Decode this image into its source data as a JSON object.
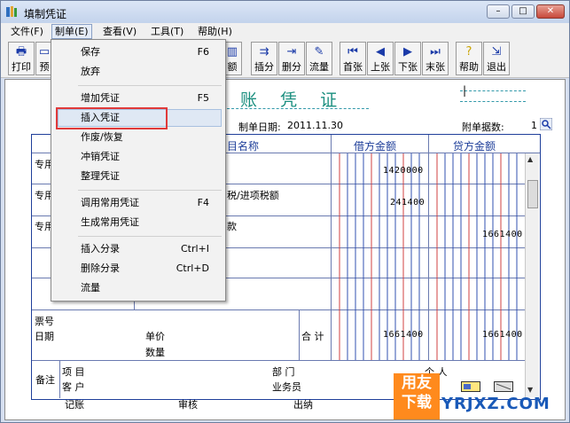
{
  "window": {
    "title": "填制凭证",
    "controls": {
      "minimize": "–",
      "maximize": "□",
      "close": "✕"
    }
  },
  "menubar": {
    "items": [
      {
        "label": "文件(F)"
      },
      {
        "label": "制单(E)"
      },
      {
        "label": "查看(V)"
      },
      {
        "label": "工具(T)"
      },
      {
        "label": "帮助(H)"
      }
    ]
  },
  "toolbar": {
    "buttons": [
      {
        "label": "打印",
        "icon": "printer-icon"
      },
      {
        "label": "预",
        "icon": "preview-icon"
      },
      {
        "label": "额",
        "icon": "balance-icon"
      },
      {
        "label": "插分",
        "icon": "insert-entry-icon"
      },
      {
        "label": "删分",
        "icon": "delete-entry-icon"
      },
      {
        "label": "流量",
        "icon": "cashflow-icon"
      },
      {
        "label": "首张",
        "icon": "first-icon"
      },
      {
        "label": "上张",
        "icon": "prev-icon"
      },
      {
        "label": "下张",
        "icon": "next-icon"
      },
      {
        "label": "末张",
        "icon": "last-icon"
      },
      {
        "label": "帮助",
        "icon": "help-icon"
      },
      {
        "label": "退出",
        "icon": "exit-icon"
      }
    ]
  },
  "dropdown": {
    "items": [
      {
        "label": "保存",
        "shortcut": "F6"
      },
      {
        "label": "放弃",
        "shortcut": ""
      },
      {
        "label": "增加凭证",
        "shortcut": "F5"
      },
      {
        "label": "插入凭证",
        "shortcut": ""
      },
      {
        "label": "作废/恢复",
        "shortcut": ""
      },
      {
        "label": "冲销凭证",
        "shortcut": ""
      },
      {
        "label": "整理凭证",
        "shortcut": ""
      },
      {
        "label": "调用常用凭证",
        "shortcut": "F4"
      },
      {
        "label": "生成常用凭证",
        "shortcut": ""
      },
      {
        "label": "插入分录",
        "shortcut": "Ctrl+I"
      },
      {
        "label": "删除分录",
        "shortcut": "Ctrl+D"
      },
      {
        "label": "流量",
        "shortcut": ""
      }
    ],
    "highlighted": "插入凭证"
  },
  "voucher": {
    "title": "账 凭 证",
    "date_label": "制单日期:",
    "date_value": "2011.11.30",
    "attach_label": "附单据数:",
    "attach_value": "1",
    "col_account": "目名称",
    "col_debit": "借方金额",
    "col_credit": "贷方金额",
    "rows": [
      {
        "summary": "专用",
        "account": "",
        "debit": "1420000",
        "credit": ""
      },
      {
        "summary": "专用",
        "account": "税/进项税额",
        "debit": "241400",
        "credit": ""
      },
      {
        "summary": "专用",
        "account": "款",
        "debit": "",
        "credit": "1661400"
      }
    ],
    "total_label": "合 计",
    "total_debit": "1661400",
    "total_credit": "1661400",
    "ticket_no": "票号",
    "date": "日期",
    "unit_price": "单价",
    "quantity": "数量",
    "remarks": "备注",
    "project": "项  目",
    "customer": "客  户",
    "dept": "部  门",
    "salesman": "业务员",
    "person": "个  人",
    "bookkeeping": "记账",
    "audit": "审核",
    "cashier": "出纳"
  },
  "watermark": {
    "badge": "用友\n下载",
    "site": "YRJXZ.COM"
  }
}
